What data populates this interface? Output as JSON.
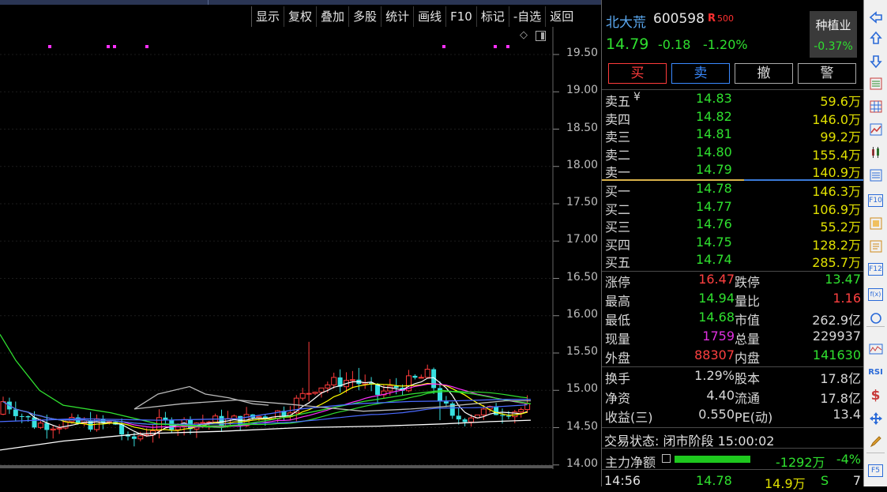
{
  "toolbar": {
    "items": [
      "显示",
      "复权",
      "叠加",
      "多股",
      "统计",
      "画线",
      "F10",
      "标记",
      "-自选",
      "返回"
    ]
  },
  "chart": {
    "y_ticks": [
      "19.50",
      "19.00",
      "18.50",
      "18.00",
      "17.50",
      "17.00",
      "16.50",
      "16.00",
      "15.50",
      "15.00",
      "14.50",
      "14.00"
    ],
    "colors": {
      "up": "#ff3b3b",
      "down": "#38e0e0",
      "ma5": "#ffffff",
      "ma10": "#ffff00",
      "ma20": "#ff30ff",
      "ma30": "#30e030",
      "ma60": "#4a6aff",
      "ma120": "#bbbbbb",
      "ma250": "#ffffff",
      "marker": "#ff30ff"
    }
  },
  "stock": {
    "name": "北大荒",
    "code": "600598",
    "badge_r": "R",
    "badge_num": "500",
    "price": "14.79",
    "change": "-0.18",
    "change_pct": "-1.20%",
    "sector_name": "种植业",
    "sector_pct": "-0.37%"
  },
  "trade_buttons": {
    "buy": "买",
    "sell": "卖",
    "cancel": "撤",
    "alert": "警"
  },
  "orderbook": {
    "asks": [
      {
        "label": "卖五",
        "price": "14.83",
        "vol": "59.6万"
      },
      {
        "label": "卖四",
        "price": "14.82",
        "vol": "146.0万"
      },
      {
        "label": "卖三",
        "price": "14.81",
        "vol": "99.2万"
      },
      {
        "label": "卖二",
        "price": "14.80",
        "vol": "155.4万"
      },
      {
        "label": "卖一",
        "price": "14.79",
        "vol": "140.9万"
      }
    ],
    "ask_currency": "¥",
    "bids": [
      {
        "label": "买一",
        "price": "14.78",
        "vol": "146.3万"
      },
      {
        "label": "买二",
        "price": "14.77",
        "vol": "106.9万"
      },
      {
        "label": "买三",
        "price": "14.76",
        "vol": "55.2万"
      },
      {
        "label": "买四",
        "price": "14.75",
        "vol": "128.2万"
      },
      {
        "label": "买五",
        "price": "14.74",
        "vol": "285.7万"
      }
    ]
  },
  "stats": [
    {
      "l1": "涨停",
      "v1": "16.47",
      "c1": "#ff4040",
      "l2": "跌停",
      "v2": "13.47",
      "c2": "#2fe02f"
    },
    {
      "l1": "最高",
      "v1": "14.94",
      "c1": "#2fe02f",
      "l2": "量比",
      "v2": "1.16",
      "c2": "#ff4040"
    },
    {
      "l1": "最低",
      "v1": "14.68",
      "c1": "#2fe02f",
      "l2": "市值",
      "v2": "262.9亿",
      "c2": "#d8d8d8"
    },
    {
      "l1": "现量",
      "v1": "1759",
      "c1": "#e030e0",
      "l2": "总量",
      "v2": "229937",
      "c2": "#d8d8d8"
    },
    {
      "l1": "外盘",
      "v1": "88307",
      "c1": "#ff4040",
      "l2": "内盘",
      "v2": "141630",
      "c2": "#2fe02f"
    }
  ],
  "stats2": [
    {
      "l1": "换手",
      "v1": "1.29%",
      "c1": "#d8d8d8",
      "l2": "股本",
      "v2": "17.8亿",
      "c2": "#d8d8d8"
    },
    {
      "l1": "净资",
      "v1": "4.40",
      "c1": "#d8d8d8",
      "l2": "流通",
      "v2": "17.8亿",
      "c2": "#d8d8d8"
    },
    {
      "l1": "收益(三)",
      "v1": "0.550",
      "c1": "#d8d8d8",
      "l2": "PE(动)",
      "v2": "13.4",
      "c2": "#d8d8d8"
    }
  ],
  "trade_status": "交易状态: 闭市阶段 15:00:02",
  "capital": {
    "label": "主力净额",
    "value": "-1292万",
    "pct": "-4%"
  },
  "tick": {
    "time": "14:56",
    "price": "14.78",
    "vol": "14.9万",
    "side": "S",
    "num": "7"
  },
  "icons": [
    "arrow-left-icon",
    "arrow-up-icon",
    "arrow-down-icon",
    "quote-list-icon",
    "grid-icon",
    "line-chart-icon",
    "candle-icon",
    "list-icon",
    "f10-icon",
    "doc-icon",
    "notes-icon",
    "f12-icon",
    "formula-icon",
    "circle-icon",
    "wave-icon",
    "rsi-icon",
    "dollar-icon",
    "move-icon",
    "pencil-icon",
    "f5-icon"
  ],
  "icon_labels": {
    "f10": "F10",
    "f12": "F12",
    "f5": "F5",
    "rsi": "RSI",
    "dollar": "$",
    "formula": "f(x)"
  }
}
